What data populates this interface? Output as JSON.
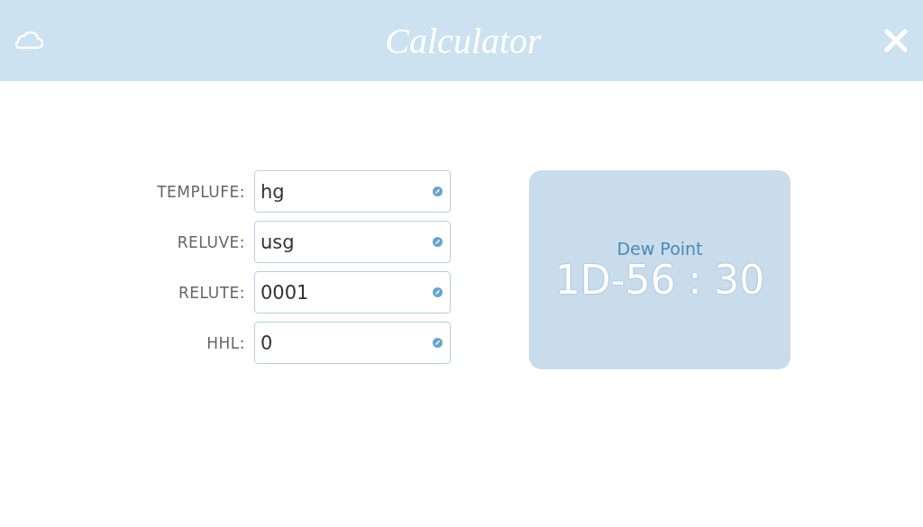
{
  "window": {
    "title": "Calculator"
  },
  "fields": [
    {
      "label": "TEMPLUFE:",
      "value": "hg"
    },
    {
      "label": "RELUVE:",
      "value": "usg"
    },
    {
      "label": "RELUTE:",
      "value": "0001"
    },
    {
      "label": "HHL:",
      "value": "0"
    }
  ],
  "result": {
    "value": "1D-56 : 30",
    "label": "Dew Point"
  }
}
